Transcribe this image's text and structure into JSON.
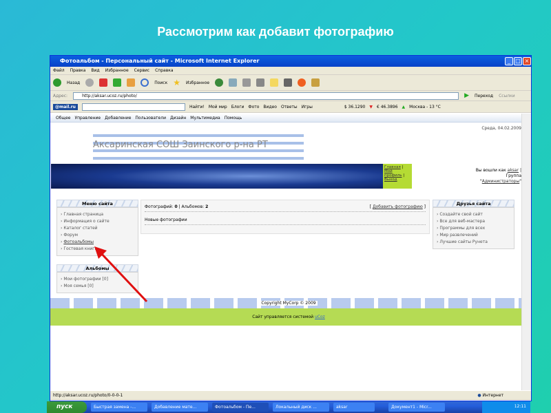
{
  "slide_title": "Рассмотрим как добавит фотографию",
  "browser": {
    "title": "Фотоальбом - Персональный сайт - Microsoft Internet Explorer",
    "menu": [
      "Файл",
      "Правка",
      "Вид",
      "Избранное",
      "Сервис",
      "Справка"
    ],
    "toolbar": {
      "back": "Назад",
      "search": "Поиск",
      "favorites": "Избранное"
    },
    "address_label": "Адрес:",
    "address": "http://aksar.ucoz.ru/photo/",
    "go": "Переход",
    "links": "Ссылки",
    "mailbar": {
      "logo": "@mail.ru",
      "find": "Найти!",
      "items": [
        "Мой мир",
        "Блоги",
        "Фото",
        "Видео",
        "Ответы",
        "Игры"
      ],
      "usd": "$ 36.1290",
      "eur": "€ 46.3896",
      "weather": "Москва - 13 °C"
    },
    "status_url": "http://aksar.ucoz.ru/photo/0-0-0-1",
    "status_zone": "Интернет"
  },
  "site": {
    "nav": [
      "Общее",
      "Управление",
      "Добавление",
      "Пользователи",
      "Дизайн",
      "Мультимедиа",
      "Помощь"
    ],
    "date": "Среда, 04.02.2009",
    "logo_text": "Аксаринская СОШ Заинского р-на РТ",
    "user_links": [
      "Главная",
      "Мой профиль",
      "Выход"
    ],
    "login": {
      "prefix": "Вы вошли как",
      "user": "aksar",
      "group_prefix": "Группа",
      "group": "Администраторы"
    },
    "menu": {
      "title": "Меню сайта",
      "items": [
        "Главная страница",
        "Информация о сайте",
        "Каталог статей",
        "Форум",
        "Фотоальбомы",
        "Гостевая книга"
      ]
    },
    "albums": {
      "title": "Альбомы",
      "items": [
        "Мои фотографии [0]",
        "Моя семья [0]"
      ]
    },
    "main": {
      "photos_label": "Фотографий:",
      "photos": "0",
      "albums_label": "Альбомов:",
      "albums": "2",
      "add_photo": "Добавить фотографию",
      "new_photos": "Новые фотографии"
    },
    "friends": {
      "title": "Друзья сайта",
      "items": [
        "Создайте свой сайт",
        "Все для веб-мастера",
        "Программы для всех",
        "Мир развлечений",
        "Лучшие сайты Рунета"
      ]
    },
    "copyright": "Copyright MyCorp © 2009",
    "powered": "Сайт управляется системой",
    "powered_link": "uCoz"
  },
  "taskbar": {
    "start": "пуск",
    "items": [
      "Быстрая замена -...",
      "Добавление мате...",
      "Фотоальбом - Пе...",
      "Локальный диск ...",
      "aksar",
      "Документ1 - Micr..."
    ],
    "clock": "12:11"
  }
}
